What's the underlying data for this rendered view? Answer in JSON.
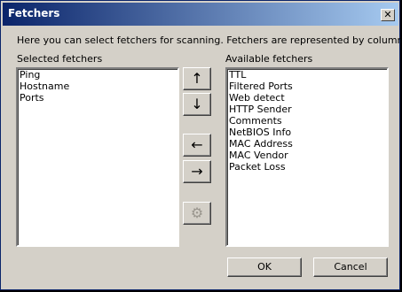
{
  "window": {
    "title": "Fetchers",
    "close_label": "✕"
  },
  "description": "Here you can select fetchers for scanning. Fetchers are represented by columns.",
  "selected": {
    "label": "Selected fetchers",
    "items": [
      "Ping",
      "Hostname",
      "Ports"
    ]
  },
  "available": {
    "label": "Available fetchers",
    "items": [
      "TTL",
      "Filtered Ports",
      "Web detect",
      "HTTP Sender",
      "Comments",
      "NetBIOS Info",
      "MAC Address",
      "MAC Vendor",
      "Packet Loss"
    ]
  },
  "buttons": {
    "up": "↑",
    "down": "↓",
    "left": "←",
    "right": "→",
    "prefs": "⚙",
    "ok": "OK",
    "cancel": "Cancel"
  },
  "icons": {
    "up": "arrow-up-icon",
    "down": "arrow-down-icon",
    "left": "arrow-left-icon",
    "right": "arrow-right-icon",
    "prefs": "gear-icon"
  }
}
